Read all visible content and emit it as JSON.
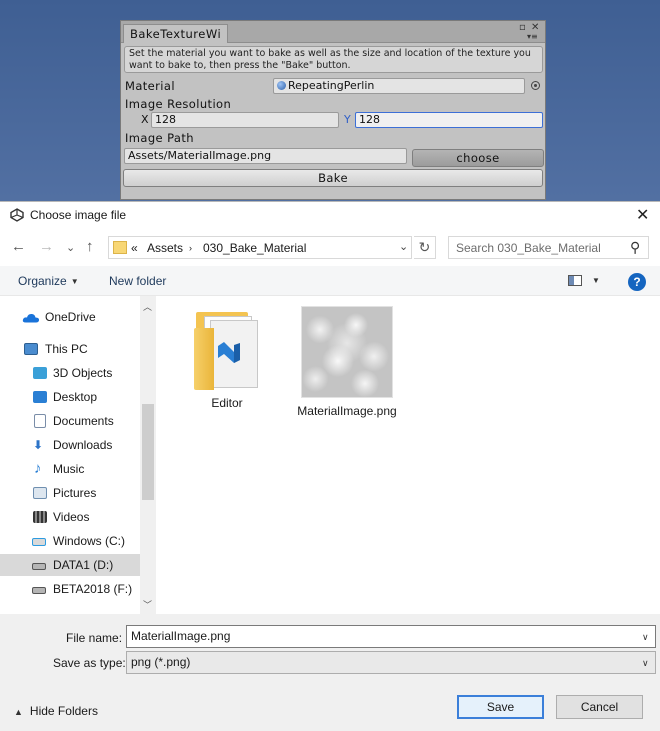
{
  "unity": {
    "tab_title": "BakeTextureWi",
    "help_text": "Set the material you want to bake as well as the size and location of the texture you want to bake to, then press the \"Bake\" button.",
    "material_label": "Material",
    "material_value": "RepeatingPerlin",
    "resolution_label": "Image Resolution",
    "x_label": "X",
    "x_value": "128",
    "y_label": "Y",
    "y_value": "128",
    "path_label": "Image Path",
    "path_value": "Assets/MaterialImage.png",
    "choose_label": "choose",
    "bake_label": "Bake"
  },
  "dialog": {
    "title": "Choose image file",
    "nav": {
      "back": "←",
      "forward": "→",
      "recent": "⌄",
      "up": "↑"
    },
    "address": {
      "overflow": "«",
      "crumbs": [
        "Assets",
        "030_Bake_Material"
      ]
    },
    "search_placeholder": "Search 030_Bake_Material",
    "commands": {
      "organize": "Organize",
      "new_folder": "New folder",
      "help": "?"
    },
    "nav_pane": [
      {
        "label": "OneDrive",
        "icon": "onedrive-icon",
        "color": "#1a73d9"
      },
      {
        "label": "This PC",
        "icon": "computer-icon",
        "color": "#4a8ccf"
      },
      {
        "label": "3D Objects",
        "icon": "3d-objects-icon",
        "color": "#3aa0d8"
      },
      {
        "label": "Desktop",
        "icon": "desktop-icon",
        "color": "#2a7fd4"
      },
      {
        "label": "Documents",
        "icon": "documents-icon",
        "color": "#7a8da8"
      },
      {
        "label": "Downloads",
        "icon": "downloads-icon",
        "color": "#2d74c8"
      },
      {
        "label": "Music",
        "icon": "music-icon",
        "color": "#2a7fd4"
      },
      {
        "label": "Pictures",
        "icon": "pictures-icon",
        "color": "#6f8fb0"
      },
      {
        "label": "Videos",
        "icon": "videos-icon",
        "color": "#4a4a4a"
      },
      {
        "label": "Windows (C:)",
        "icon": "windows-drive-icon",
        "color": "#2d9be0"
      },
      {
        "label": "DATA1 (D:)",
        "icon": "drive-icon",
        "color": "#555555"
      },
      {
        "label": "BETA2018 (F:)",
        "icon": "drive-icon",
        "color": "#555555"
      }
    ],
    "selected_nav": "DATA1 (D:)",
    "files": [
      {
        "name": "Editor",
        "type": "folder"
      },
      {
        "name": "MaterialImage.png",
        "type": "image"
      }
    ],
    "file_name_label": "File name:",
    "file_name_value": "MaterialImage.png",
    "save_type_label": "Save as type:",
    "save_type_value": "png (*.png)",
    "hide_folders": "Hide Folders",
    "save_label": "Save",
    "cancel_label": "Cancel"
  }
}
